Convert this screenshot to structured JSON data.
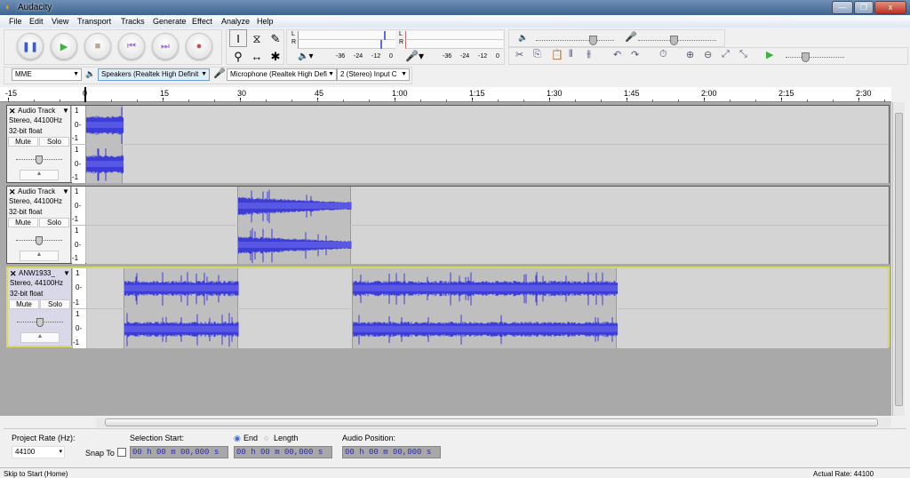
{
  "window": {
    "title": "Audacity",
    "minimize": "—",
    "restore": "❐",
    "close": "x"
  },
  "menu": [
    "File",
    "Edit",
    "View",
    "Transport",
    "Tracks",
    "Generate",
    "Effect",
    "Analyze",
    "Help"
  ],
  "transport": [
    {
      "name": "pause",
      "glyph": "❚❚",
      "color": "#3a5ad8"
    },
    {
      "name": "play",
      "glyph": "▶",
      "color": "#3cb040"
    },
    {
      "name": "stop",
      "glyph": "■",
      "color": "#b8a888"
    },
    {
      "name": "skip-start",
      "glyph": "⏮",
      "color": "#a070e0"
    },
    {
      "name": "skip-end",
      "glyph": "⏭",
      "color": "#a070e0"
    },
    {
      "name": "record",
      "glyph": "●",
      "color": "#d04848"
    }
  ],
  "tools": [
    {
      "name": "selection-tool",
      "glyph": "I"
    },
    {
      "name": "envelope-tool",
      "glyph": "⧖"
    },
    {
      "name": "draw-tool",
      "glyph": "✎"
    },
    {
      "name": "zoom-tool",
      "glyph": "⚲"
    },
    {
      "name": "timeshift-tool",
      "glyph": "↔"
    },
    {
      "name": "multi-tool",
      "glyph": "✱"
    }
  ],
  "meters": {
    "play_l": "L",
    "play_r": "R",
    "rec_l": "L",
    "rec_r": "R",
    "scale": [
      "-36",
      "-24",
      "-12",
      "0"
    ]
  },
  "edit_tools": [
    "✂",
    "⎘",
    "📋",
    "⫴",
    "⫵",
    "↶",
    "↷",
    "⏱",
    "⊕",
    "⊖",
    "⤢",
    "⤡",
    "▶"
  ],
  "device": {
    "host": "MME",
    "output": "Speakers (Realtek High Definit",
    "input": "Microphone (Realtek High Defi",
    "channels": "2 (Stereo) Input C"
  },
  "ruler": [
    "-15",
    "0",
    "15",
    "30",
    "45",
    "1:00",
    "1:15",
    "1:30",
    "1:45",
    "2:00",
    "2:15",
    "2:30"
  ],
  "tracks": [
    {
      "name": "Audio Track",
      "info1": "Stereo, 44100Hz",
      "info2": "32-bit float",
      "mute": "Mute",
      "solo": "Solo",
      "selected": false,
      "clips": [
        [
          0,
          7.3
        ]
      ]
    },
    {
      "name": "Audio Track",
      "info1": "Stereo, 44100Hz",
      "info2": "32-bit float",
      "mute": "Mute",
      "solo": "Solo",
      "selected": false,
      "clips": [
        [
          29.5,
          51.5
        ]
      ]
    },
    {
      "name": "ANW1933_",
      "info1": "Stereo, 44100Hz",
      "info2": "32-bit float",
      "mute": "Mute",
      "solo": "Solo",
      "selected": true,
      "clips": [
        [
          7.3,
          29.5
        ],
        [
          51.5,
          103
        ]
      ]
    }
  ],
  "vruler": [
    "1",
    "0-",
    "-1"
  ],
  "selection_bar": {
    "project_rate_label": "Project Rate (Hz):",
    "project_rate": "44100",
    "snap_to": "Snap To",
    "selection_start_label": "Selection Start:",
    "end_label": "End",
    "length_label": "Length",
    "audio_position_label": "Audio Position:",
    "start": "00 h 00 m 00,000 s",
    "end": "00 h 00 m 00,000 s",
    "position": "00 h 00 m 00,000 s"
  },
  "status": {
    "left": "Skip to Start (Home)",
    "right": "Actual Rate: 44100"
  },
  "colors": {
    "wave": "#3c3cd8",
    "wave_rms": "#6464ea",
    "selected_border": "#d8d860"
  }
}
